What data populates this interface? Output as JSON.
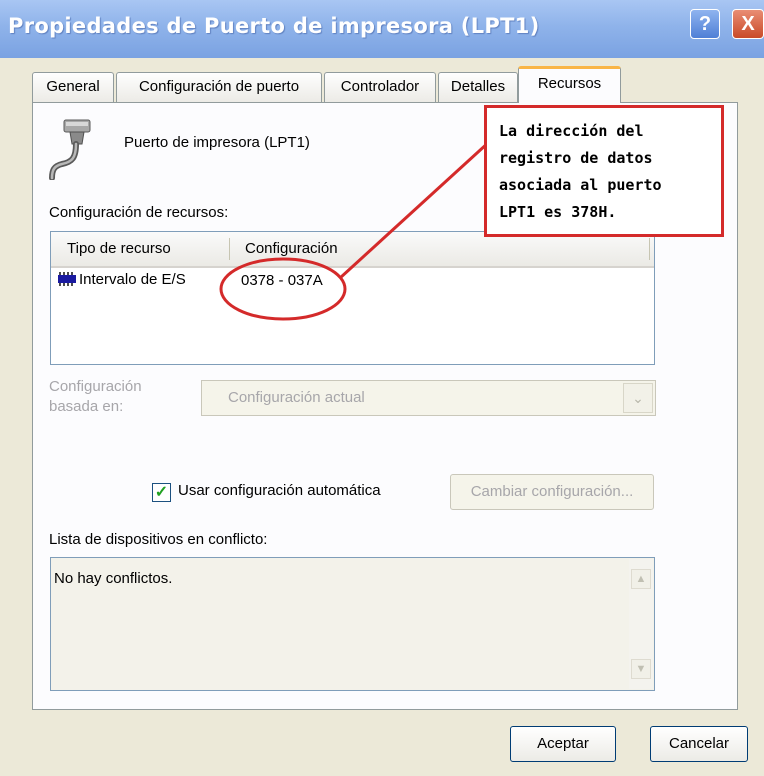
{
  "window": {
    "title": "Propiedades de Puerto de impresora (LPT1)",
    "help_label": "?",
    "close_label": "X"
  },
  "tabs": [
    {
      "label": "General"
    },
    {
      "label": "Configuración de puerto"
    },
    {
      "label": "Controlador"
    },
    {
      "label": "Detalles"
    },
    {
      "label": "Recursos",
      "active": true
    }
  ],
  "device": {
    "name": "Puerto de impresora (LPT1)",
    "icon": "printer-port-icon"
  },
  "resources": {
    "section_label": "Configuración de recursos:",
    "columns": [
      "Tipo de recurso",
      "Configuración"
    ],
    "rows": [
      {
        "type": "Intervalo de E/S",
        "setting": "0378 - 037A",
        "icon": "io-range-chip-icon"
      }
    ]
  },
  "based_on": {
    "label_line1": "Configuración",
    "label_line2": "basada en:",
    "value": "Configuración actual"
  },
  "auto_config": {
    "checked": true,
    "label": "Usar configuración automática",
    "change_button": "Cambiar configuración..."
  },
  "conflicts": {
    "label": "Lista de dispositivos en conflicto:",
    "text": "No hay conflictos."
  },
  "buttons": {
    "ok": "Aceptar",
    "cancel": "Cancelar"
  },
  "annotation": {
    "lines": [
      "La dirección del",
      "registro de datos",
      "asociada al puerto",
      "LPT1 es 378H."
    ],
    "color": "#d42a2a"
  }
}
